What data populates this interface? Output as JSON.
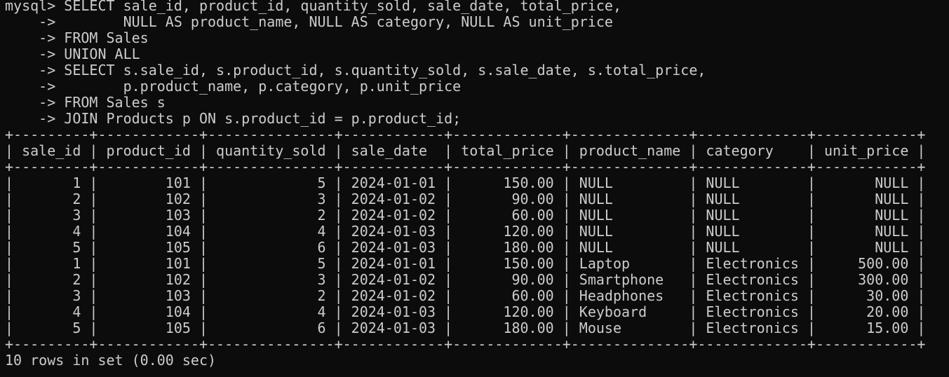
{
  "terminal": {
    "background": "#0c0c0c",
    "foreground": "#cccccc",
    "lines": [
      "mysql> SELECT sale_id, product_id, quantity_sold, sale_date, total_price,",
      "    ->        NULL AS product_name, NULL AS category, NULL AS unit_price",
      "    -> FROM Sales",
      "    -> UNION ALL",
      "    -> SELECT s.sale_id, s.product_id, s.quantity_sold, s.sale_date, s.total_price,",
      "    ->        p.product_name, p.category, p.unit_price",
      "    -> FROM Sales s",
      "    -> JOIN Products p ON s.product_id = p.product_id;",
      "+---------+------------+---------------+------------+-------------+--------------+-------------+------------+",
      "| sale_id | product_id | quantity_sold | sale_date  | total_price | product_name | category    | unit_price |",
      "+---------+------------+---------------+------------+-------------+--------------+-------------+------------+",
      "|       1 |        101 |             5 | 2024-01-01 |      150.00 | NULL         | NULL        |       NULL |",
      "|       2 |        102 |             3 | 2024-01-02 |       90.00 | NULL         | NULL        |       NULL |",
      "|       3 |        103 |             2 | 2024-01-02 |       60.00 | NULL         | NULL        |       NULL |",
      "|       4 |        104 |             4 | 2024-01-03 |      120.00 | NULL         | NULL        |       NULL |",
      "|       5 |        105 |             6 | 2024-01-03 |      180.00 | NULL         | NULL        |       NULL |",
      "|       1 |        101 |             5 | 2024-01-01 |      150.00 | Laptop       | Electronics |     500.00 |",
      "|       2 |        102 |             3 | 2024-01-02 |       90.00 | Smartphone   | Electronics |     300.00 |",
      "|       3 |        103 |             2 | 2024-01-02 |       60.00 | Headphones   | Electronics |      30.00 |",
      "|       4 |        104 |             4 | 2024-01-03 |      120.00 | Keyboard     | Electronics |      20.00 |",
      "|       5 |        105 |             6 | 2024-01-03 |      180.00 | Mouse        | Electronics |      15.00 |",
      "+---------+------------+---------------+------------+-------------+--------------+-------------+------------+",
      "10 rows in set (0.00 sec)"
    ]
  }
}
